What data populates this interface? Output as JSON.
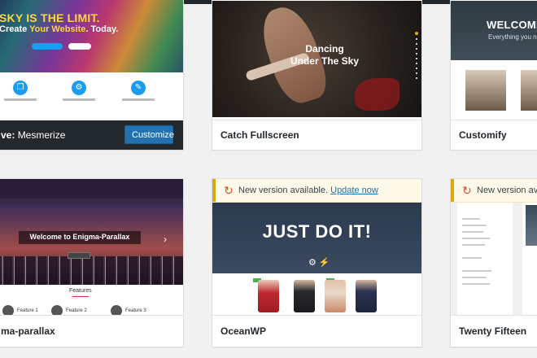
{
  "admin_bar": {
    "accent_color": "#dc3232"
  },
  "themes": [
    {
      "name": "Mesmerize",
      "active": true,
      "active_prefix": "ve:",
      "customize_label": "Customize",
      "preview": {
        "headline_white": "SKY IS THE LIMIT.",
        "headline_yellow_prefix": "Create ",
        "headline_yellow": "Your Website",
        "headline_suffix": ". Today.",
        "feature_icons": [
          "copy-icon",
          "gears-icon",
          "pencil-icon"
        ]
      }
    },
    {
      "name": "Catch Fullscreen",
      "preview": {
        "title_line1": "Dancing",
        "title_line2": "Under The Sky"
      }
    },
    {
      "name": "Customify",
      "preview": {
        "headline": "WELCOME",
        "subline": "Everything you nee"
      }
    },
    {
      "name": "ma-parallax",
      "preview": {
        "caption": "Welcome to Enigma-Parallax",
        "section_title": "Features",
        "features": [
          "Feature 1",
          "Feature 2",
          "Feature 3"
        ]
      }
    },
    {
      "name": "OceanWP",
      "update_notice": {
        "text": "New version available. ",
        "link": "Update now"
      },
      "preview": {
        "hero": "JUST DO IT!"
      }
    },
    {
      "name": "Twenty Fifteen",
      "update_notice": {
        "text": "New version availa"
      }
    }
  ]
}
